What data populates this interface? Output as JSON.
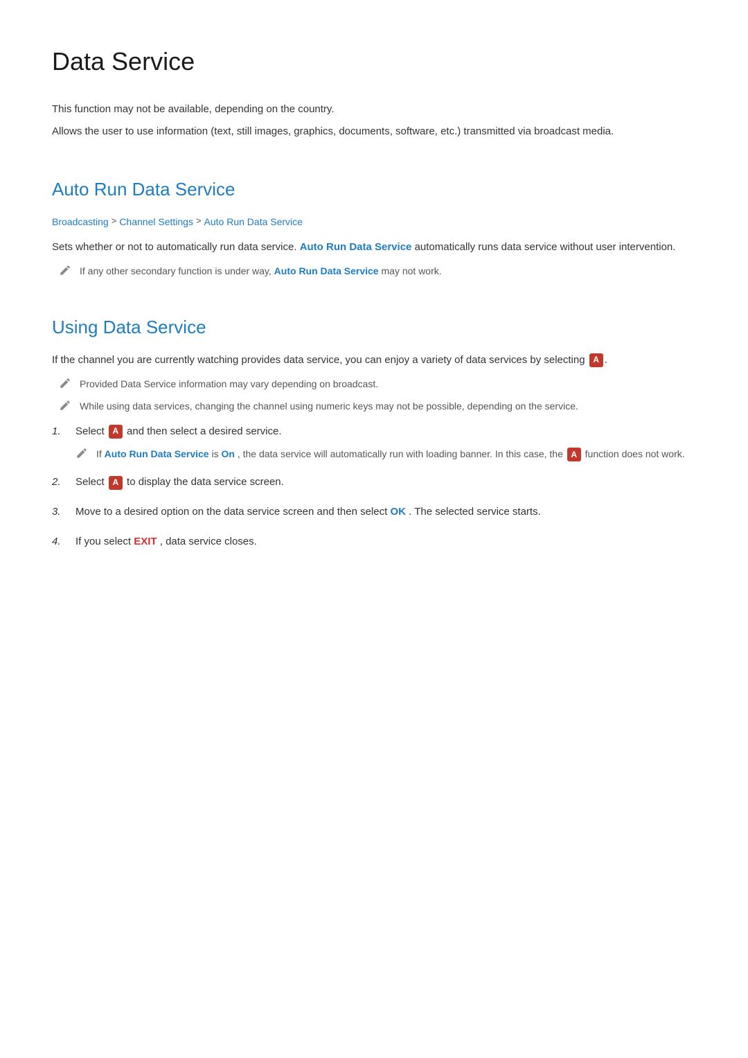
{
  "page": {
    "title": "Data Service",
    "intro": [
      "This function may not be available, depending on the country.",
      "Allows the user to use information (text, still images, graphics, documents, software, etc.) transmitted via broadcast media."
    ]
  },
  "section1": {
    "title": "Auto Run Data Service",
    "breadcrumb": {
      "items": [
        "Broadcasting",
        "Channel Settings",
        "Auto Run Data Service"
      ],
      "separators": [
        ">",
        ">"
      ]
    },
    "body": "Sets whether or not to automatically run data service.",
    "highlight1": "Auto Run Data Service",
    "body2": "automatically runs data service without user intervention.",
    "note": "If any other secondary function is under way,",
    "note_highlight": "Auto Run Data Service",
    "note2": "may not work."
  },
  "section2": {
    "title": "Using Data Service",
    "intro": "If the channel you are currently watching provides data service, you can enjoy a variety of data services by selecting",
    "note1": "Provided Data Service information may vary depending on broadcast.",
    "note2": "While using data services, changing the channel using numeric keys may not be possible, depending on the service.",
    "steps": [
      {
        "num": "1.",
        "text_before": "Select",
        "text_after": "and then select a desired service.",
        "nested_note_before": "If",
        "nested_highlight": "Auto Run Data Service",
        "nested_note_mid": "is",
        "nested_on": "On",
        "nested_note_after": ", the data service will automatically run with loading banner. In this case, the",
        "nested_note_end": "function does not work."
      },
      {
        "num": "2.",
        "text_before": "Select",
        "text_after": "to display the data service screen."
      },
      {
        "num": "3.",
        "text": "Move to a desired option on the data service screen and then select",
        "ok_text": "OK",
        "text_after": ". The selected service starts."
      },
      {
        "num": "4.",
        "text_before": "If you select",
        "exit_text": "EXIT",
        "text_after": ", data service closes."
      }
    ]
  }
}
